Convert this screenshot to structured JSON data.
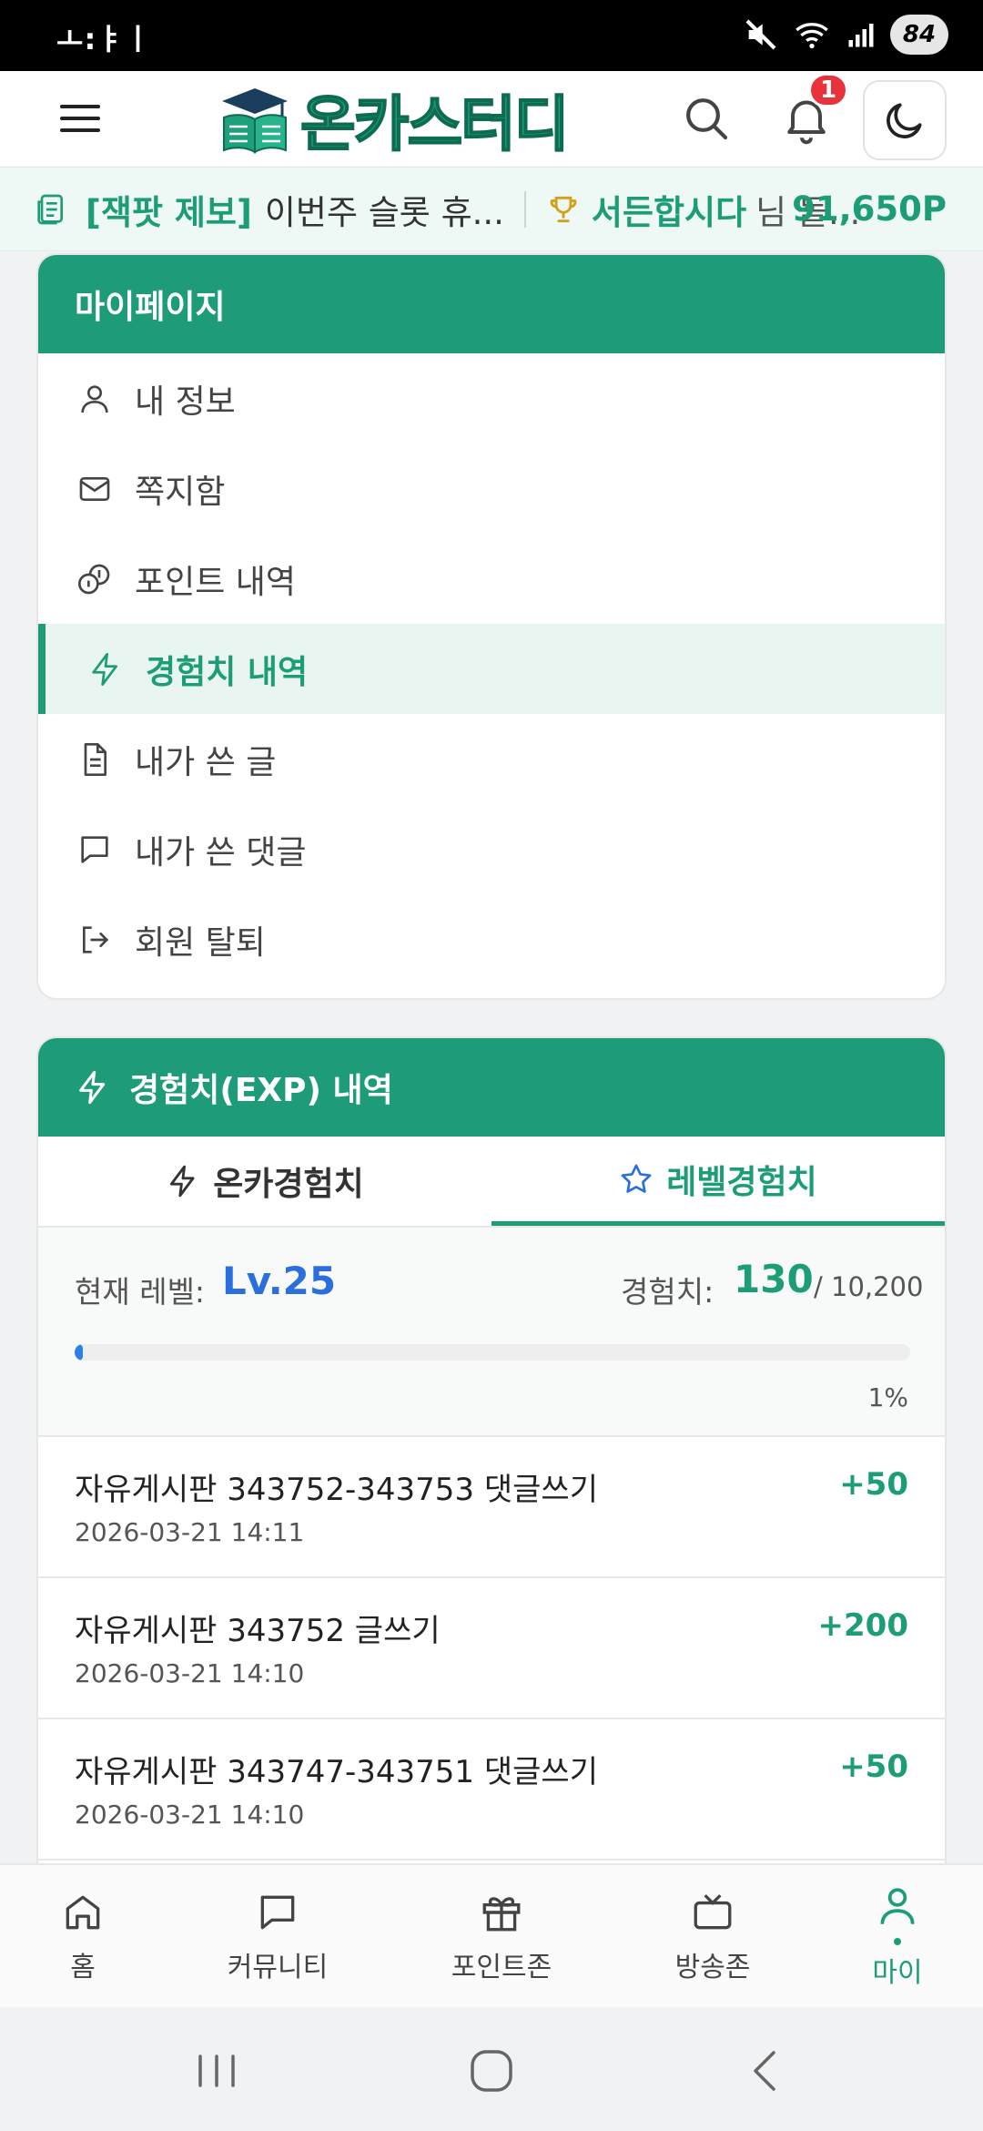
{
  "status": {
    "time": "ㅗ:ㅑㅣ",
    "battery": "84"
  },
  "header": {
    "logo_text": "온카스터디",
    "notification_count": "1"
  },
  "ticker": {
    "tag": "[잭팟 제보]",
    "text": "이번주 슬롯 휴...",
    "user": "서든합시다",
    "suffix": "님 돌...",
    "points": "91,650P"
  },
  "mypage": {
    "title": "마이페이지",
    "items": [
      {
        "label": "내 정보",
        "icon": "user-icon"
      },
      {
        "label": "쪽지함",
        "icon": "mail-icon"
      },
      {
        "label": "포인트 내역",
        "icon": "coins-icon"
      },
      {
        "label": "경험치 내역",
        "icon": "bolt-icon"
      },
      {
        "label": "내가 쓴 글",
        "icon": "document-icon"
      },
      {
        "label": "내가 쓴 댓글",
        "icon": "comment-icon"
      },
      {
        "label": "회원 탈퇴",
        "icon": "logout-icon"
      }
    ]
  },
  "exp": {
    "title": "경험치(EXP) 내역",
    "tabs": [
      {
        "label": "온카경험치",
        "icon": "bolt-icon"
      },
      {
        "label": "레벨경험치",
        "icon": "star-icon"
      }
    ],
    "level_label": "현재 레벨:",
    "level_value": "Lv.25",
    "exp_label": "경험치:",
    "exp_value": "130",
    "exp_total": "/ 10,200",
    "progress_percent": 1,
    "progress_text": "1%",
    "history": [
      {
        "title": "자유게시판 343752-343753 댓글쓰기",
        "date": "2026-03-21 14:11",
        "amount": "+50"
      },
      {
        "title": "자유게시판 343752 글쓰기",
        "date": "2026-03-21 14:10",
        "amount": "+200"
      },
      {
        "title": "자유게시판 343747-343751 댓글쓰기",
        "date": "2026-03-21 14:10",
        "amount": "+50"
      }
    ]
  },
  "bottom_nav": [
    {
      "label": "홈",
      "icon": "home-icon"
    },
    {
      "label": "커뮤니티",
      "icon": "chat-icon"
    },
    {
      "label": "포인트존",
      "icon": "gift-icon"
    },
    {
      "label": "방송존",
      "icon": "tv-icon"
    },
    {
      "label": "마이",
      "icon": "user-icon"
    }
  ],
  "colors": {
    "accent": "#1e9b79",
    "level_blue": "#2a6fdb",
    "badge_red": "#e8323c"
  }
}
